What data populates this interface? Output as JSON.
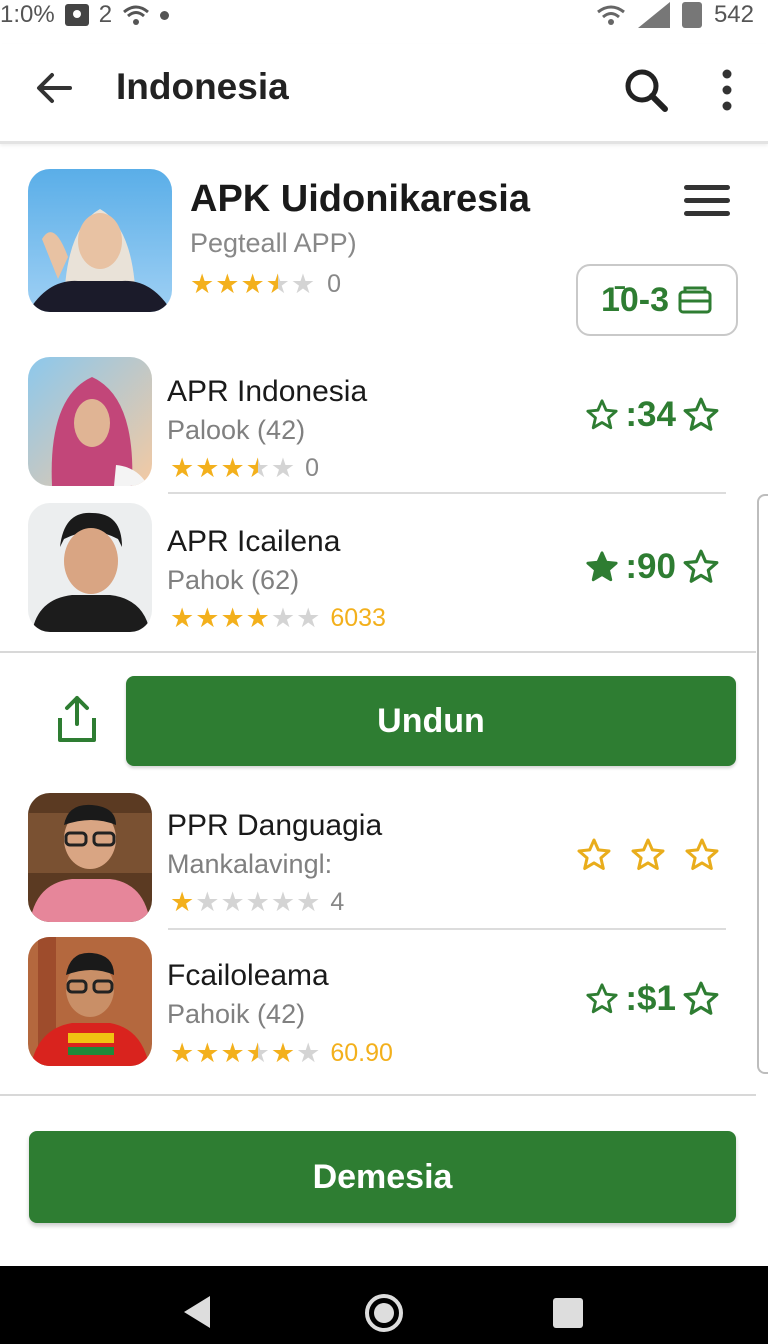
{
  "status_bar": {
    "left_text": "1:0%",
    "notif_count": "2",
    "battery_text": "542"
  },
  "app_bar": {
    "title": "Indonesia"
  },
  "featured": {
    "title": "APK Uidonikaresia",
    "subtitle": "Pegteall APP)",
    "rating_stars": 3.5,
    "rating_count": "0",
    "price_label": "1̄0-3"
  },
  "list_top": [
    {
      "name": "APR Indonesia",
      "subtitle": "Palook (42)",
      "rating_stars": 3.5,
      "count": "0",
      "count_highlight": false,
      "price": ":34"
    },
    {
      "name": "APR Icailena",
      "subtitle": "Pahok (62)",
      "rating_stars": 4,
      "count": "6033",
      "count_highlight": true,
      "price": ":90"
    }
  ],
  "actions": {
    "primary_label": "Undun"
  },
  "list_bottom": [
    {
      "name": "PPR Danguagia",
      "subtitle": "Mankalavingl:",
      "rating_stars": 1,
      "count": "4",
      "count_highlight": false,
      "price": ""
    },
    {
      "name": "Fcailoleama",
      "subtitle": "Pahoik (42)",
      "rating_stars": 3.5,
      "count": "60.90",
      "count_highlight": true,
      "price": ":$1"
    }
  ],
  "footer": {
    "button_label": "Demesia"
  },
  "colors": {
    "accent": "#2e7d32",
    "star": "#f3b01c",
    "star_empty": "#d4d4d4"
  }
}
